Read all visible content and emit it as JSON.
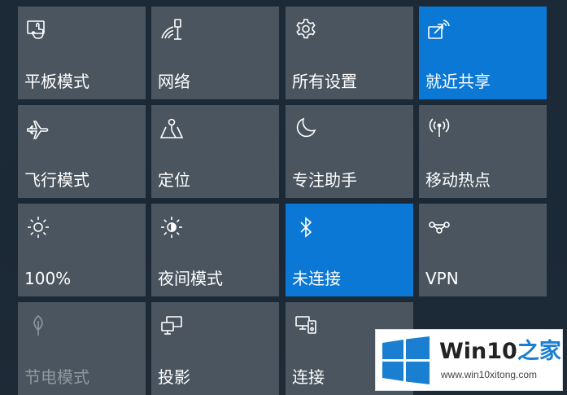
{
  "colors": {
    "tile_background": "#4a555f",
    "tile_active_background": "#0a78d4",
    "panel_background": "#1b2835",
    "label_text": "#ffffff",
    "label_disabled_text": "#8f989f",
    "watermark_accent": "#1a7fd0"
  },
  "quick_actions": [
    {
      "label": "平板模式",
      "icon": "tablet-mode-icon",
      "active": false,
      "enabled": true
    },
    {
      "label": "网络",
      "icon": "network-icon",
      "active": false,
      "enabled": true
    },
    {
      "label": "所有设置",
      "icon": "gear-icon",
      "active": false,
      "enabled": true
    },
    {
      "label": "就近共享",
      "icon": "nearby-share-icon",
      "active": true,
      "enabled": true
    },
    {
      "label": "飞行模式",
      "icon": "airplane-icon",
      "active": false,
      "enabled": true
    },
    {
      "label": "定位",
      "icon": "location-icon",
      "active": false,
      "enabled": true
    },
    {
      "label": "专注助手",
      "icon": "moon-icon",
      "active": false,
      "enabled": true
    },
    {
      "label": "移动热点",
      "icon": "hotspot-icon",
      "active": false,
      "enabled": true
    },
    {
      "label": "100%",
      "icon": "brightness-icon",
      "active": false,
      "enabled": true
    },
    {
      "label": "夜间模式",
      "icon": "night-light-icon",
      "active": false,
      "enabled": true
    },
    {
      "label": "未连接",
      "icon": "bluetooth-icon",
      "active": true,
      "enabled": true
    },
    {
      "label": "VPN",
      "icon": "vpn-icon",
      "active": false,
      "enabled": true
    },
    {
      "label": "节电模式",
      "icon": "battery-saver-icon",
      "active": false,
      "enabled": false
    },
    {
      "label": "投影",
      "icon": "project-icon",
      "active": false,
      "enabled": true
    },
    {
      "label": "连接",
      "icon": "connect-icon",
      "active": false,
      "enabled": true
    }
  ],
  "watermark": {
    "brand_main": "Win10",
    "brand_suffix": "之家",
    "url": "www.win10xitong.com",
    "logo_icon": "windows-logo-icon"
  }
}
